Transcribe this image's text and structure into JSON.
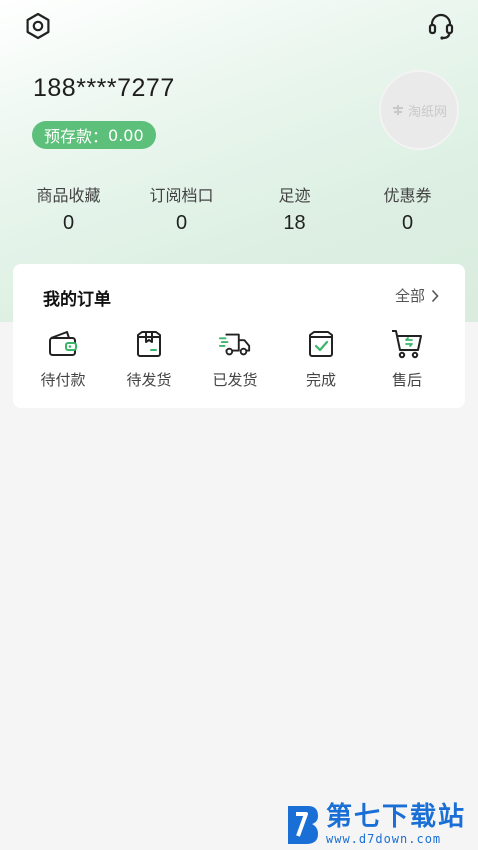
{
  "header": {
    "phone": "188****7277",
    "balance_label": "预存款：",
    "balance_value": "0.00",
    "avatar_text": "淘纸网"
  },
  "stats": [
    {
      "label": "商品收藏",
      "value": "0"
    },
    {
      "label": "订阅档口",
      "value": "0"
    },
    {
      "label": "足迹",
      "value": "18"
    },
    {
      "label": "优惠券",
      "value": "0"
    }
  ],
  "orders": {
    "title": "我的订单",
    "all_label": "全部",
    "items": [
      {
        "label": "待付款",
        "icon": "wallet-icon"
      },
      {
        "label": "待发货",
        "icon": "package-icon"
      },
      {
        "label": "已发货",
        "icon": "truck-icon"
      },
      {
        "label": "完成",
        "icon": "box-check-icon"
      },
      {
        "label": "售后",
        "icon": "cart-return-icon"
      }
    ]
  },
  "watermark": {
    "title": "第七下载站",
    "url": "www.d7down.com"
  },
  "colors": {
    "accent": "#5cc07a",
    "header_bg": "#dcefe2",
    "page_bg": "#f5f5f5"
  }
}
